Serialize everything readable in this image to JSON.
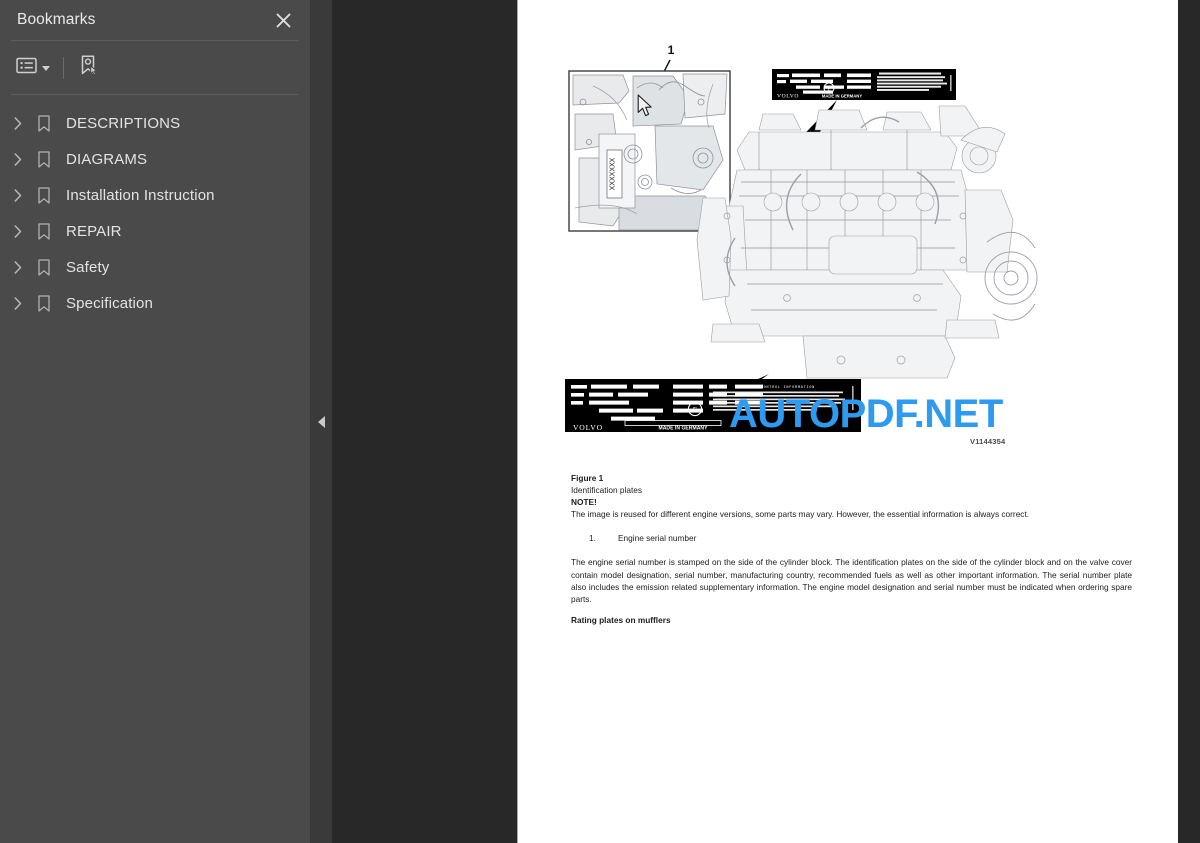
{
  "sidebar": {
    "title": "Bookmarks",
    "close_icon": "close-icon",
    "toolbar": {
      "list_options_icon": "list-options-icon",
      "list_options_caret_icon": "chevron-down-icon",
      "new_bookmark_icon": "new-bookmark-icon"
    },
    "items": [
      {
        "label": "DESCRIPTIONS",
        "expand_icon": "chevron-right-icon",
        "icon": "bookmark-icon"
      },
      {
        "label": "DIAGRAMS",
        "expand_icon": "chevron-right-icon",
        "icon": "bookmark-icon"
      },
      {
        "label": "Installation Instruction",
        "expand_icon": "chevron-right-icon",
        "icon": "bookmark-icon"
      },
      {
        "label": "REPAIR",
        "expand_icon": "chevron-right-icon",
        "icon": "bookmark-icon"
      },
      {
        "label": "Safety",
        "expand_icon": "chevron-right-icon",
        "icon": "bookmark-icon"
      },
      {
        "label": "Specification",
        "expand_icon": "chevron-right-icon",
        "icon": "bookmark-icon"
      }
    ],
    "collapse_handle_icon": "collapse-left-icon"
  },
  "watermark": {
    "text": "AUTOPDF.NET",
    "color": "#2e9bf0"
  },
  "page": {
    "figure": {
      "callout_number": "1",
      "image_code": "V1144354",
      "inset_stamp_label": "XXXXXXX",
      "plates": [
        {
          "brand": "VOLVO",
          "origin": "MADE IN GERMANY"
        },
        {
          "brand": "VOLVO",
          "origin": "MADE IN GERMANY",
          "heading": "EMISSION CONTROL INFORMATION",
          "lines": [
            "THIS ENGINE COMPLIES WITH US EPA AND CALIFORNIA",
            "REGULATIONS FOR 2013 NONROAD DIESEL ENGINES",
            "FUEL: DIESEL  ECS:  DPF  TWC  OXC  EGR  SCR  PFSS",
            "FAMILY MODEL/TR-RGDA    POWER CATEGORY 56-130kW",
            "DATE OF MANUFACTURE 08/2013",
            "ULTRA LOW SULFUR FUEL ONLY"
          ]
        }
      ]
    },
    "text": {
      "figure_title": "Figure 1",
      "figure_caption": "Identification plates",
      "note_label": "NOTE!",
      "note_body": "The image is reused for different engine versions, some parts may vary. However, the essential information is always correct.",
      "list": [
        {
          "number": "1.",
          "text": "Engine serial number"
        }
      ],
      "paragraph": "The engine serial number is stamped on the side of the cylinder block. The identification plates on the side of the cylinder block and on the valve cover contain model designation, serial number, manufacturing country, recommended fuels as well as other important information. The serial number plate also includes the emission related supplementary information. The engine model designation and serial number must be indicated when ordering spare parts.",
      "subheading": "Rating plates on mufflers"
    }
  },
  "cursor": {
    "icon": "mouse-pointer-icon"
  }
}
